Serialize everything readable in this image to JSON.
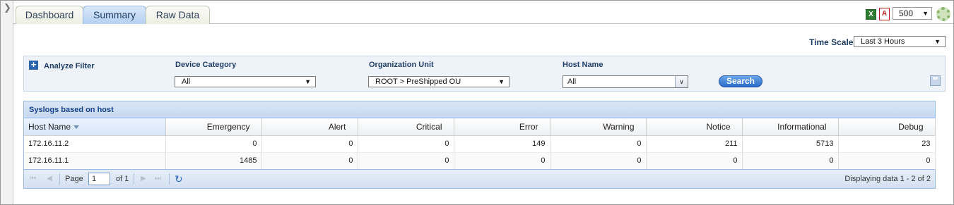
{
  "tabs": [
    {
      "label": "Dashboard",
      "active": false
    },
    {
      "label": "Summary",
      "active": true
    },
    {
      "label": "Raw Data",
      "active": false
    }
  ],
  "toolbar": {
    "export_excel_icon": "excel-icon",
    "export_pdf_icon": "pdf-icon",
    "rows_per_page": "500",
    "settings_icon": "gear-icon"
  },
  "time_scale": {
    "label": "Time Scale",
    "value": "Last 3 Hours"
  },
  "filter": {
    "title": "Analyze Filter",
    "device_category": {
      "label": "Device Category",
      "value": "All"
    },
    "organization_unit": {
      "label": "Organization Unit",
      "value": "ROOT > PreShipped OU"
    },
    "host_name": {
      "label": "Host Name",
      "value": "All"
    },
    "search_label": "Search"
  },
  "grid": {
    "title": "Syslogs based on host",
    "columns": [
      "Host Name",
      "Emergency",
      "Alert",
      "Critical",
      "Error",
      "Warning",
      "Notice",
      "Informational",
      "Debug"
    ],
    "rows": [
      [
        "172.16.11.2",
        "0",
        "0",
        "0",
        "149",
        "0",
        "211",
        "5713",
        "23"
      ],
      [
        "172.16.11.1",
        "1485",
        "0",
        "0",
        "0",
        "0",
        "0",
        "0",
        "0"
      ]
    ],
    "pager": {
      "page_label": "Page",
      "page_value": "1",
      "of_label": "of 1",
      "displaying": "Displaying data 1 - 2 of 2"
    }
  },
  "colors": {
    "accent": "#15428b",
    "button": "#2a6bc6",
    "panel": "#eef3fa"
  }
}
